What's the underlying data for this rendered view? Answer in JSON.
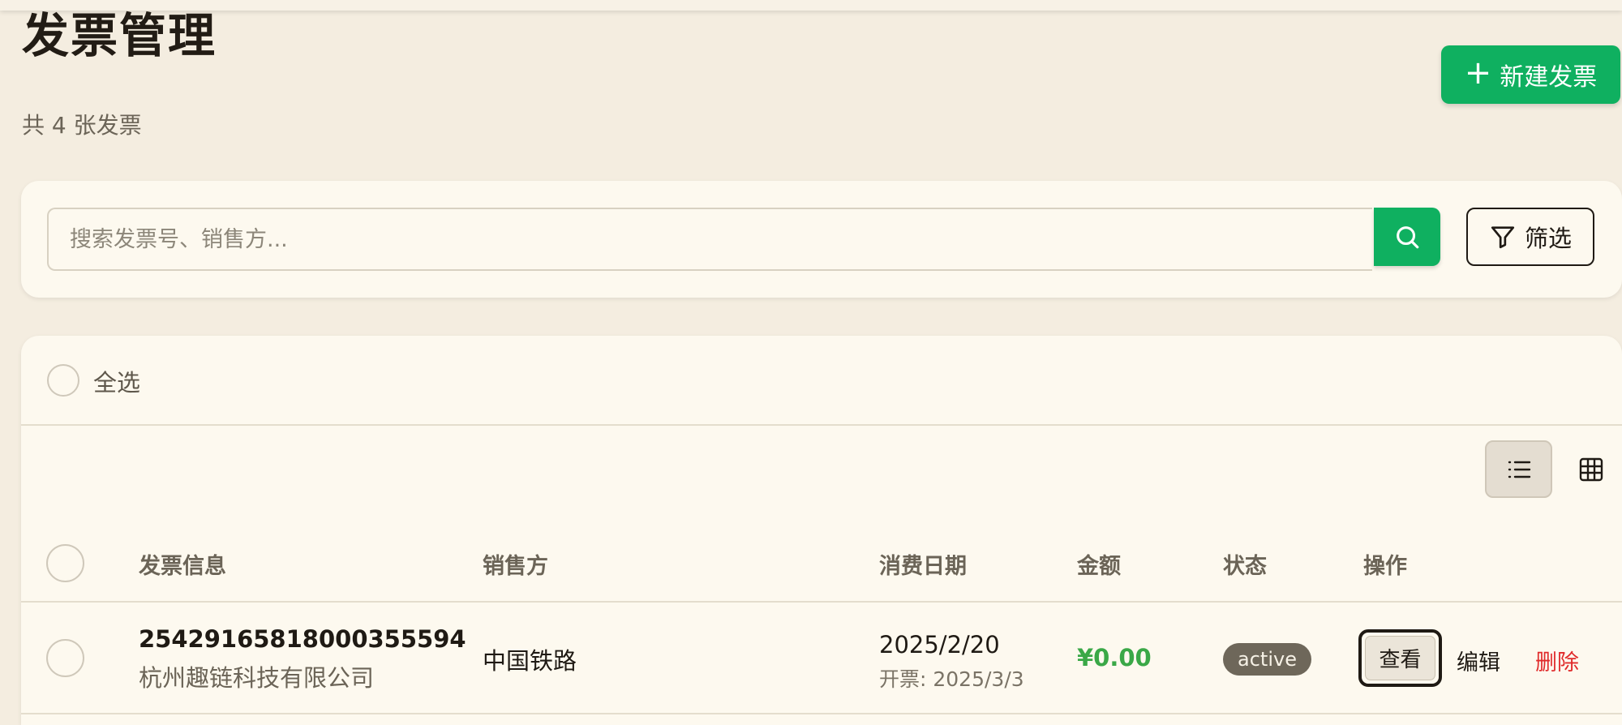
{
  "header": {
    "title": "发票管理",
    "subtitle": "共 4 张发票",
    "new_button_label": "新建发票",
    "new_button_icon": "plus-icon"
  },
  "search": {
    "placeholder": "搜索发票号、销售方...",
    "value": "",
    "search_icon": "search-icon",
    "filter_label": "筛选",
    "filter_icon": "filter-icon"
  },
  "list": {
    "select_all_label": "全选",
    "view_modes": [
      "list-view-icon",
      "grid-view-icon"
    ],
    "active_view": "list",
    "columns": [
      "发票信息",
      "销售方",
      "消费日期",
      "金额",
      "状态",
      "操作"
    ],
    "rows": [
      {
        "invoice_number": "25429165818000355594",
        "company": "杭州趣链科技有限公司",
        "seller": "中国铁路",
        "date": "2025/2/20",
        "issue_date": "开票: 2025/3/3",
        "amount": "¥0.00",
        "status": "active",
        "actions": {
          "view": "查看",
          "edit": "编辑",
          "delete": "删除"
        }
      }
    ]
  },
  "colors": {
    "accent": "#0fb060",
    "background": "#f4ede0",
    "card": "#fdf9ef",
    "amount": "#3aa847",
    "delete": "#e02b2b",
    "status_badge": "#6e675a"
  }
}
